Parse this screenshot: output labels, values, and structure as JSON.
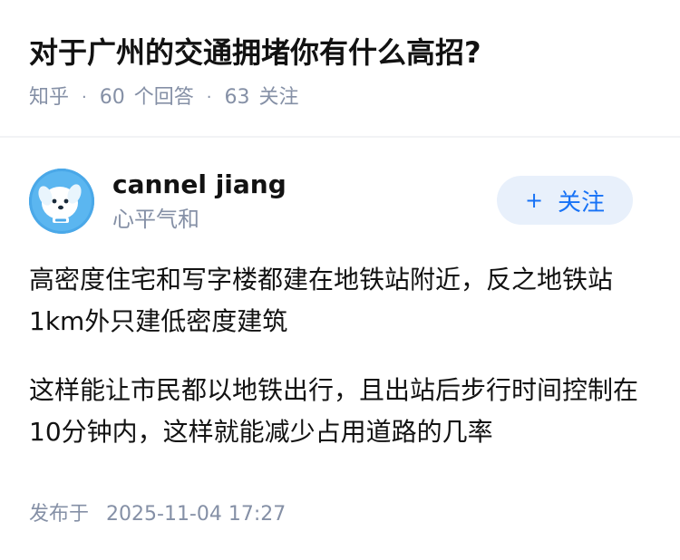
{
  "question": {
    "title": "对于广州的交通拥堵你有什么高招?",
    "source": "知乎",
    "answer_count": "60",
    "answer_label": "个回答",
    "follow_count": "63",
    "follow_label": "关注"
  },
  "author": {
    "name": "cannel jiang",
    "bio": "心平气和",
    "follow_button": "关注",
    "follow_icon": "plus-icon"
  },
  "answer": {
    "paragraphs": [
      "高密度住宅和写字楼都建在地铁站附近，反之地铁站1km外只建低密度建筑",
      "这样能让市民都以地铁出行，且出站后步行时间控制在10分钟内，这样就能减少占用道路的几率"
    ],
    "published_label": "发布于",
    "published_time": "2025-11-04 17:27"
  },
  "colors": {
    "accent": "#1772f6",
    "accent_bg": "#e8f0fb",
    "meta_gray": "#8590a6",
    "text": "#121212",
    "avatar_bg": "#4aa8e8"
  }
}
